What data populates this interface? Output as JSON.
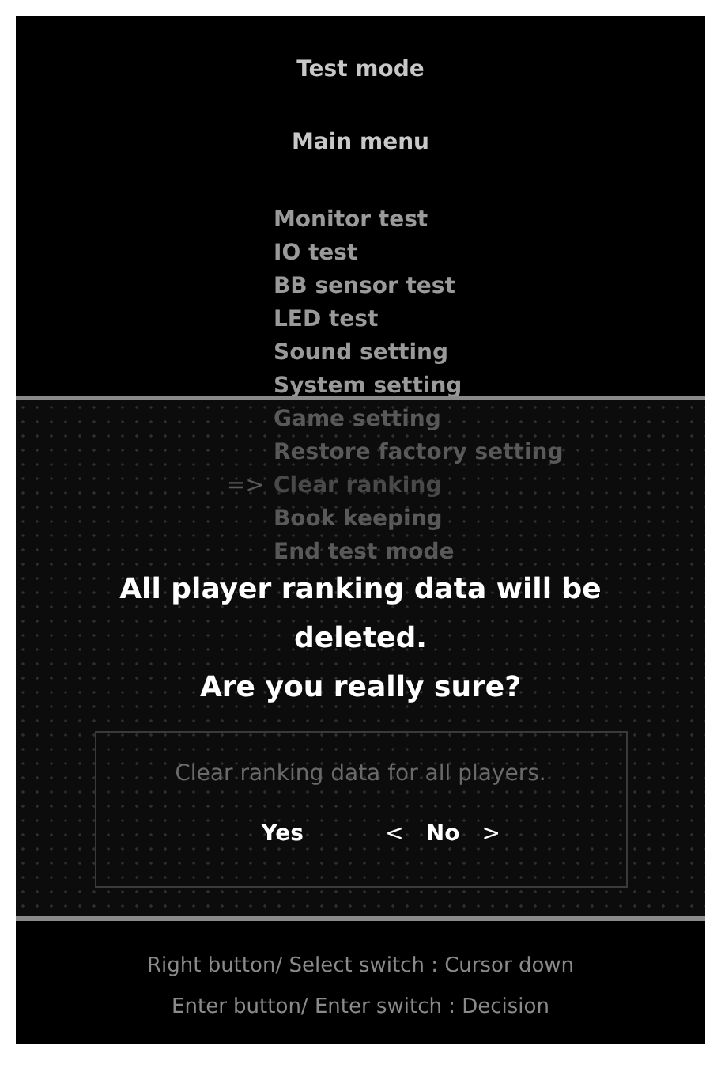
{
  "screen": {
    "title": "Test mode",
    "subtitle": "Main menu"
  },
  "menu": {
    "cursor": "=>",
    "items": [
      {
        "label": "Monitor test",
        "selected": false
      },
      {
        "label": "IO test",
        "selected": false
      },
      {
        "label": "BB sensor test",
        "selected": false
      },
      {
        "label": "LED test",
        "selected": false
      },
      {
        "label": "Sound setting",
        "selected": false
      },
      {
        "label": "System setting",
        "selected": false
      },
      {
        "label": "Game setting",
        "selected": false
      },
      {
        "label": "Restore factory setting",
        "selected": false
      },
      {
        "label": "Clear ranking",
        "selected": true
      },
      {
        "label": "Book keeping",
        "selected": false
      },
      {
        "label": "End test mode",
        "selected": false
      }
    ]
  },
  "dialog": {
    "message": [
      "All player ranking data will be deleted.",
      "Are you really sure?"
    ],
    "description": "Clear ranking data for all players.",
    "selection_left": "<",
    "selection_right": ">",
    "options": [
      {
        "label": "Yes",
        "selected": false
      },
      {
        "label": "No",
        "selected": true
      }
    ]
  },
  "help": [
    "Right button/ Select switch : Cursor down",
    "Enter button/ Enter switch : Decision"
  ]
}
